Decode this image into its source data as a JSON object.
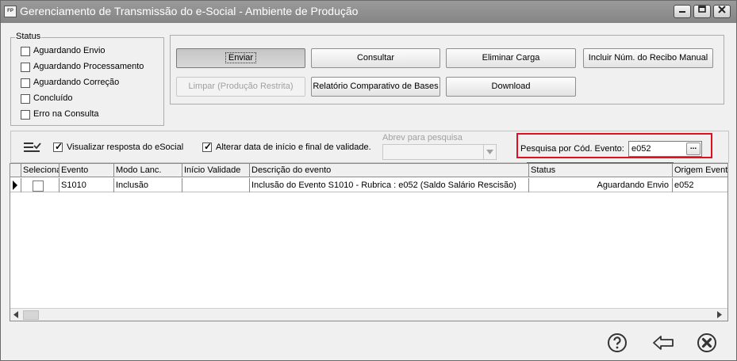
{
  "window": {
    "app_icon": "FP",
    "title": "Gerenciamento de Transmissão do e-Social - Ambiente de Produção",
    "min_icon": "minimize-icon",
    "max_icon": "maximize-icon",
    "close_icon": "close-icon"
  },
  "status_group": {
    "label": "Status",
    "options": [
      {
        "label": "Aguardando Envio",
        "checked": false
      },
      {
        "label": "Aguardando Processamento",
        "checked": false
      },
      {
        "label": "Aguardando Correção",
        "checked": false
      },
      {
        "label": "Concluído",
        "checked": false
      },
      {
        "label": "Erro na Consulta",
        "checked": false
      }
    ]
  },
  "actions": {
    "enviar": "Enviar",
    "consultar": "Consultar",
    "eliminar_carga": "Eliminar Carga",
    "incluir_recibo": "Incluir Núm. do Recibo Manual",
    "limpar": "Limpar (Produção Restrita)",
    "relatorio": "Relatório Comparativo de Bases",
    "download": "Download"
  },
  "filters": {
    "visualizar_resposta": {
      "label": "Visualizar resposta do eSocial",
      "checked": true
    },
    "alterar_data": {
      "label": "Alterar data de início e final de validade.",
      "checked": true
    },
    "abrev_label": "Abrev para pesquisa",
    "abrev_value": "",
    "pesquisa_label": "Pesquisa por Cód. Evento:",
    "pesquisa_value": "e052",
    "lookup_button": "...",
    "red_highlight": "#e01020"
  },
  "grid": {
    "columns": [
      "Seleciona",
      "Evento",
      "Modo Lanc.",
      "Início Validade",
      "Descrição do evento",
      "Status",
      "Origem Evento"
    ],
    "rows": [
      {
        "seleciona": false,
        "evento": "S1010",
        "modo": "Inclusão",
        "inicio": "",
        "descricao": "Inclusão do Evento S1010 - Rubrica : e052 (Saldo Salário Rescisão)",
        "status": "Aguardando Envio",
        "origem": "e052"
      }
    ]
  },
  "footer": {
    "help_icon": "help-icon",
    "back_icon": "back-arrow-icon",
    "exit_icon": "exit-icon"
  }
}
